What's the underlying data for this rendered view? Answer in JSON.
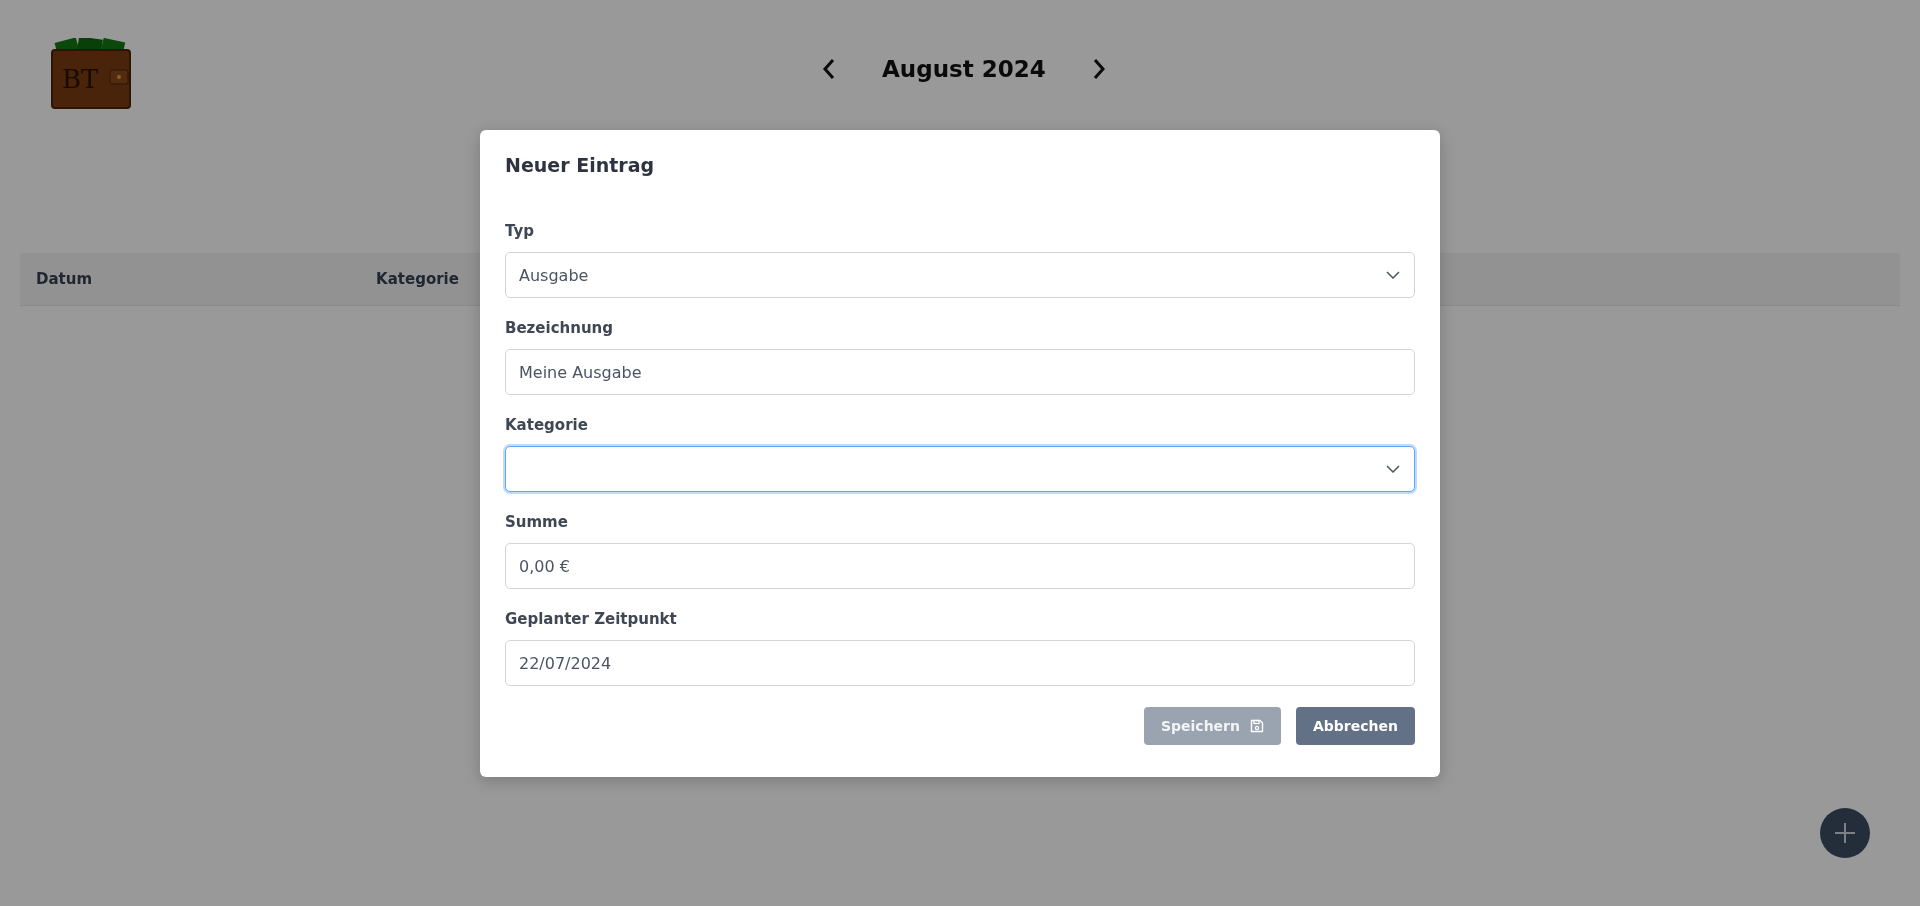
{
  "logo": {
    "text": "BT"
  },
  "header": {
    "month": "August 2024"
  },
  "table": {
    "columns": [
      "Datum",
      "Kategorie"
    ]
  },
  "dialog": {
    "title": "Neuer Eintrag",
    "fields": [
      {
        "kind": "select",
        "label": "Typ",
        "value": "Ausgabe",
        "focused": false
      },
      {
        "kind": "input",
        "label": "Bezeichnung",
        "value": "Meine Ausgabe",
        "focused": false
      },
      {
        "kind": "select",
        "label": "Kategorie",
        "focused": true
      },
      {
        "kind": "input",
        "label": "Summe",
        "value": "0,00 €",
        "focused": false
      },
      {
        "kind": "input",
        "label": "Geplanter Zeitpunkt",
        "value": "22/07/2024",
        "focused": false
      }
    ],
    "buttons": [
      {
        "kind": "save",
        "label": "Speichern",
        "disabled": true
      },
      {
        "kind": "cancel",
        "label": "Abbrechen",
        "disabled": false
      }
    ]
  }
}
